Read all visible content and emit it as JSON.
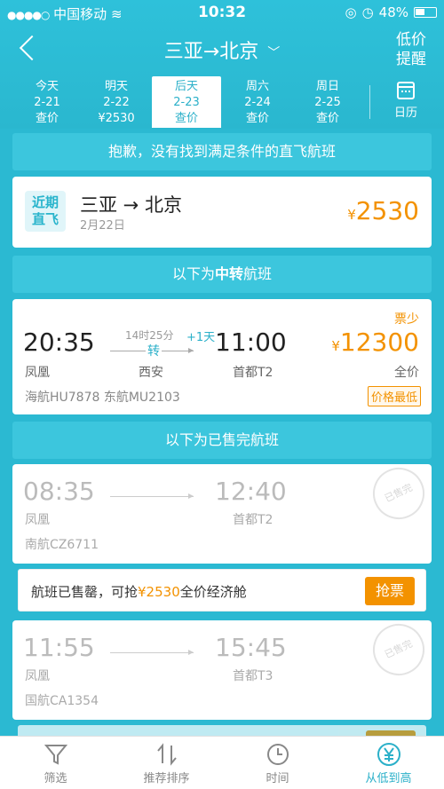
{
  "status_bar": {
    "carrier": "中国移动",
    "time": "10:32",
    "battery": "48%"
  },
  "nav": {
    "route": "三亚→北京",
    "alert_line1": "低价",
    "alert_line2": "提醒"
  },
  "date_tabs": [
    {
      "day": "今天",
      "date": "2-21",
      "price": "查价"
    },
    {
      "day": "明天",
      "date": "2-22",
      "price": "¥2530"
    },
    {
      "day": "后天",
      "date": "2-23",
      "price": "查价"
    },
    {
      "day": "周六",
      "date": "2-24",
      "price": "查价"
    },
    {
      "day": "周日",
      "date": "2-25",
      "price": "查价"
    }
  ],
  "calendar_label": "日历",
  "no_direct_banner": "抱歉，没有找到满足条件的直飞航班",
  "nearby_direct": {
    "badge_line1": "近期",
    "badge_line2": "直飞",
    "route": "三亚 → 北京",
    "date": "2月22日",
    "currency": "¥",
    "price": "2530"
  },
  "transfer_banner_pre": "以下为",
  "transfer_banner_bold": "中转",
  "transfer_banner_post": "航班",
  "transfer_flight": {
    "depart_time": "20:35",
    "duration": "14时25分",
    "transfer_label": "转",
    "day_offset": "+1天",
    "arrive_time": "11:00",
    "depart_airport": "凤凰",
    "transfer_city": "西安",
    "arrive_airport": "首都T2",
    "flight_numbers": "海航HU7878  东航MU2103",
    "ticket_status": "票少",
    "currency": "¥",
    "price": "12300",
    "cabin": "全价",
    "tag": "价格最低"
  },
  "sold_banner": "以下为已售完航班",
  "sold_flights": [
    {
      "depart_time": "08:35",
      "arrive_time": "12:40",
      "depart_airport": "凤凰",
      "arrive_airport": "首都T2",
      "flight_number": "南航CZ6711",
      "stamp": "已售完"
    },
    {
      "depart_time": "11:55",
      "arrive_time": "15:45",
      "depart_airport": "凤凰",
      "arrive_airport": "首都T3",
      "flight_number": "国航CA1354",
      "stamp": "已售完"
    }
  ],
  "grab_row": {
    "text_pre": "航班已售罄，可抢",
    "price": "¥2530",
    "text_post": "全价经济舱",
    "button": "抢票"
  },
  "tabbar": [
    {
      "label": "筛选",
      "icon": "filter-icon"
    },
    {
      "label": "推荐排序",
      "icon": "sort-icon"
    },
    {
      "label": "时间",
      "icon": "clock-icon"
    },
    {
      "label": "从低到高",
      "icon": "yen-icon"
    }
  ]
}
